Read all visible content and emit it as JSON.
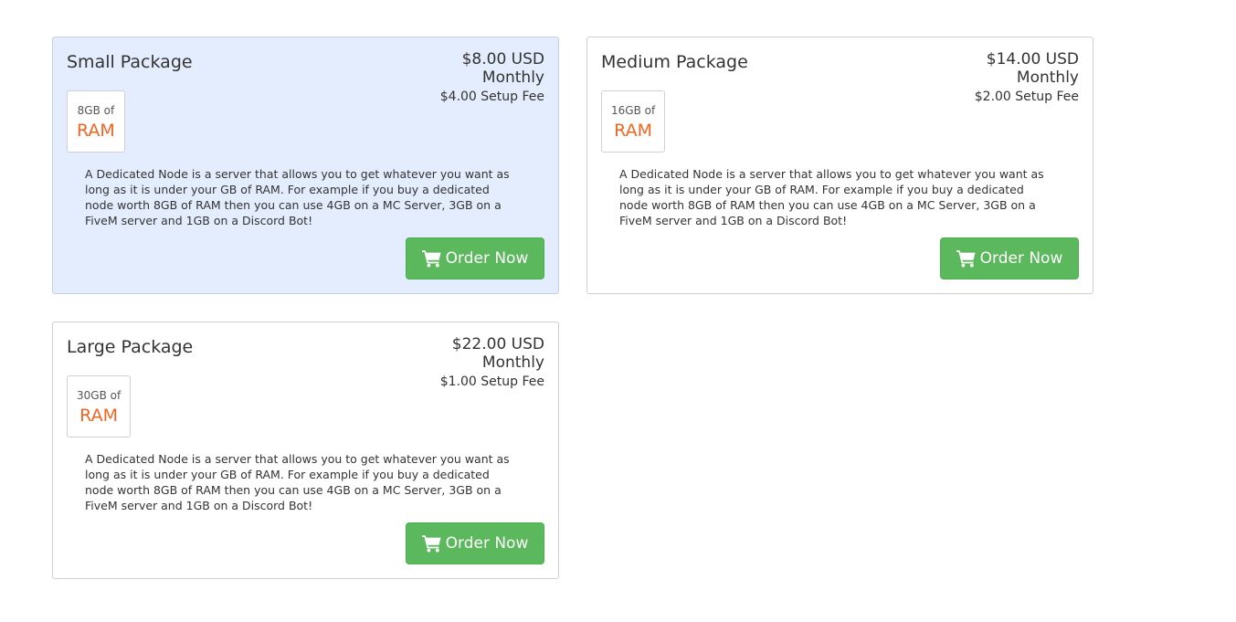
{
  "packages": [
    {
      "name": "Small Package",
      "price": "$8.00 USD",
      "cycle": "Monthly",
      "setup_fee": "$4.00 Setup Fee",
      "ram_amount": "8GB of",
      "ram_unit": "RAM",
      "description": "A Dedicated Node is a server that allows you to get whatever you want as long as it is under your GB of RAM. For example if you buy a dedicated node worth 8GB of RAM then you can use 4GB on a MC Server, 3GB on a FiveM server and 1GB on a Discord Bot!",
      "order_label": "Order Now",
      "highlighted": true
    },
    {
      "name": "Medium Package",
      "price": "$14.00 USD",
      "cycle": "Monthly",
      "setup_fee": "$2.00 Setup Fee",
      "ram_amount": "16GB of",
      "ram_unit": "RAM",
      "description": "A Dedicated Node is a server that allows you to get whatever you want as long as it is under your GB of RAM. For example if you buy a dedicated node worth 8GB of RAM then you can use 4GB on a MC Server, 3GB on a FiveM server and 1GB on a Discord Bot!",
      "order_label": "Order Now",
      "highlighted": false
    },
    {
      "name": "Large Package",
      "price": "$22.00 USD",
      "cycle": "Monthly",
      "setup_fee": "$1.00 Setup Fee",
      "ram_amount": "30GB of",
      "ram_unit": "RAM",
      "description": "A Dedicated Node is a server that allows you to get whatever you want as long as it is under your GB of RAM. For example if you buy a dedicated node worth 8GB of RAM then you can use 4GB on a MC Server, 3GB on a FiveM server and 1GB on a Discord Bot!",
      "order_label": "Order Now",
      "highlighted": false
    }
  ],
  "icons": {
    "order_button": "shopping-cart-icon"
  },
  "colors": {
    "highlight_background": "#e4edfd",
    "ram_accent": "#f26522",
    "order_button": "#5cb85c"
  }
}
